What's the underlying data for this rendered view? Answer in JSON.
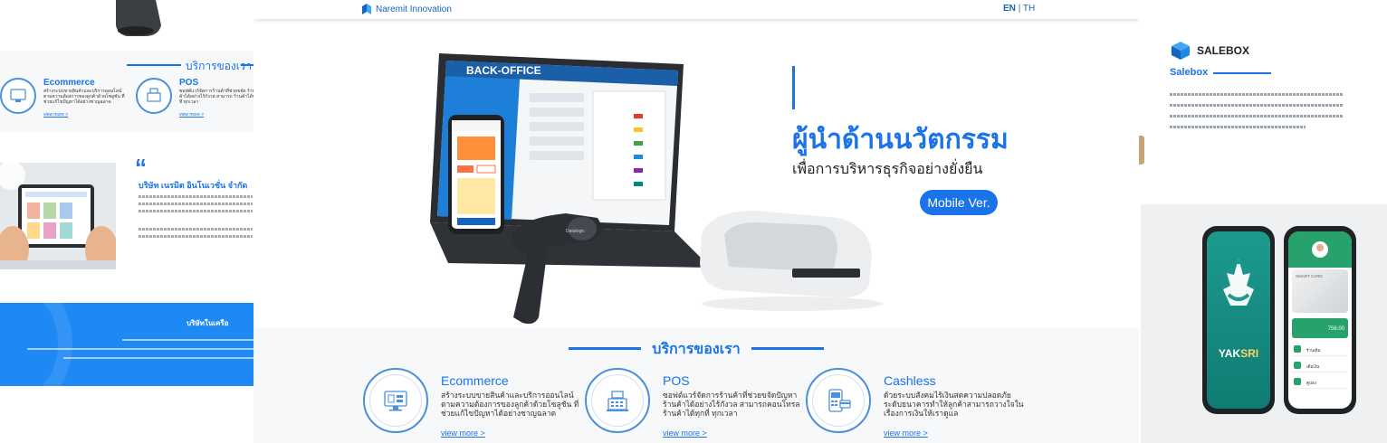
{
  "header": {
    "logo_text": "Naremit Innovation",
    "lang_en": "EN",
    "lang_sep": "|",
    "lang_th": "TH"
  },
  "hero": {
    "title": "ผู้นำด้านนวัตกรรม",
    "subtitle": "เพื่อการบริหารธุรกิจอย่างยั่งยืน",
    "mobile_button": "Mobile Ver.",
    "tablet_brand": "BACK-OFFICE",
    "scanner_brand": "Datalogic"
  },
  "services": {
    "title": "บริการของเรา",
    "items": [
      {
        "name": "Ecommerce",
        "desc": "สร้างระบบขายสินค้าและบริการออนไลน์ ตามความต้องการของลูกค้าด้วยโซลูชัน ที่ช่วยแก้ไขปัญหาได้อย่างชาญฉลาด",
        "more": "view more >",
        "icon": "ecommerce-monitor-icon"
      },
      {
        "name": "POS",
        "desc": "ซอฟต์แวร์จัดการร้านค้าที่ช่วยขจัดปัญหา ร้านค้าได้อย่างไร้กังวล สามารถคอนโทรล ร้านค้าได้ทุกที่ ทุกเวลา",
        "more": "view more >",
        "icon": "cash-register-icon"
      },
      {
        "name": "Cashless",
        "desc": "ด้วยระบบสังคมไร้เงินสดความปลอดภัย ระดับธนาคารทำให้ลูกค้าสามารถวางใจใน เรื่องการเงินให้เราดูแล",
        "more": "view more >",
        "icon": "payment-terminal-icon"
      }
    ]
  },
  "left_panel": {
    "services_title": "บริการของเรา",
    "items": [
      {
        "name": "Ecommerce",
        "desc": "สร้างระบบขายสินค้าและบริการออนไลน์ ตามความต้องการของลูกค้าด้วยโซลูชัน ที่ช่วยแก้ไขปัญหาได้อย่างชาญฉลาด",
        "more": "view more >"
      },
      {
        "name": "POS",
        "desc": "ซอฟต์แวร์จัดการร้านค้าที่ช่วยขจัด ร้านค้าได้อย่างไร้กังวล สามารถ ร้านค้าได้ทุกที่ ทุกเวลา",
        "more": "view more >"
      }
    ],
    "about_title": "บริษัท เนรมิต อินโนเวชั่น จำกัด",
    "blue_title": "บริษัทในเครือ"
  },
  "right_panel": {
    "brand": "SALEBOX",
    "sub": "Salebox",
    "app_brand_1": "YAK",
    "app_brand_2": "SRI",
    "card_label": "SMART CARD",
    "balance": "756.00",
    "rows": [
      "ร้านเติม",
      "เติมเงิน",
      "คูปอง"
    ]
  },
  "colors": {
    "brand_blue": "#1a73e8",
    "panel_blue": "#1e88f5",
    "yaksri_green": "#1d9a8e",
    "wallet_green": "#27a26d"
  }
}
